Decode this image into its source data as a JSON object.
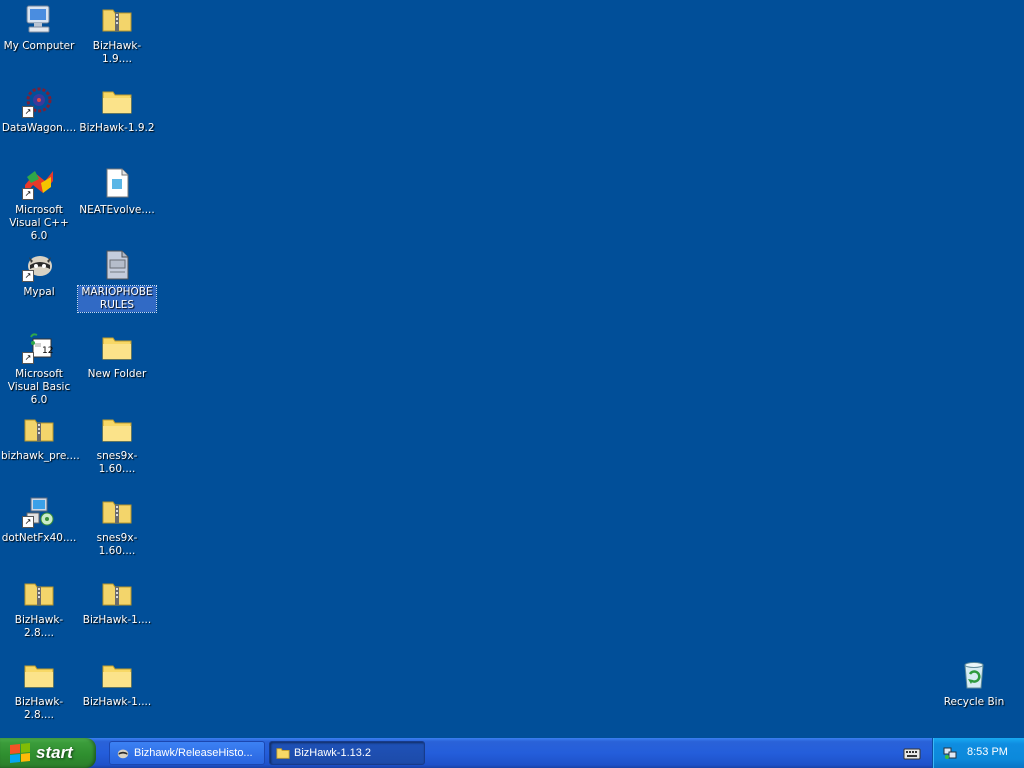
{
  "desktop": {
    "icons": [
      {
        "label": "My Computer",
        "icon": "my-computer-icon"
      },
      {
        "label": "BizHawk-1.9....",
        "icon": "zip-folder-icon"
      },
      {
        "label": "DataWagon....",
        "icon": "datawagon-icon"
      },
      {
        "label": "BizHawk-1.9.2",
        "icon": "folder-icon"
      },
      {
        "label": "Microsoft Visual C++ 6.0",
        "icon": "visual-cpp-icon"
      },
      {
        "label": "NEATEvolve....",
        "icon": "document-icon"
      },
      {
        "label": "Mypal",
        "icon": "mypal-raccoon-icon"
      },
      {
        "label": "MARIOPHOBE RULES",
        "icon": "text-file-icon",
        "selected": true
      },
      {
        "label": "Microsoft Visual Basic 6.0",
        "icon": "visual-basic-icon"
      },
      {
        "label": "New Folder",
        "icon": "folder-icon"
      },
      {
        "label": "bizhawk_pre....",
        "icon": "zip-folder-icon"
      },
      {
        "label": "snes9x-1.60....",
        "icon": "folder-icon"
      },
      {
        "label": "dotNetFx40....",
        "icon": "installer-icon"
      },
      {
        "label": "snes9x-1.60....",
        "icon": "zip-folder-icon"
      },
      {
        "label": "BizHawk-2.8....",
        "icon": "zip-folder-icon"
      },
      {
        "label": "BizHawk-1....",
        "icon": "zip-folder-icon"
      },
      {
        "label": "BizHawk-2.8....",
        "icon": "folder-icon"
      },
      {
        "label": "BizHawk-1....",
        "icon": "folder-icon"
      }
    ],
    "recycle_bin": {
      "label": "Recycle Bin",
      "icon": "recycle-bin-icon"
    },
    "background_color": "#014f99"
  },
  "taskbar": {
    "start_label": "start",
    "tasks": [
      {
        "label": "Bizhawk/ReleaseHisto...",
        "icon": "mypal-raccoon-icon",
        "active": false
      },
      {
        "label": "BizHawk-1.13.2",
        "icon": "folder-icon",
        "active": true
      }
    ],
    "tray": {
      "clock": "8:53 PM",
      "icons": [
        "keyboard-icon",
        "network-icon"
      ]
    },
    "colors": {
      "bar": "#245edb",
      "start": "#2f8f2f",
      "tray": "#0c89db"
    }
  }
}
